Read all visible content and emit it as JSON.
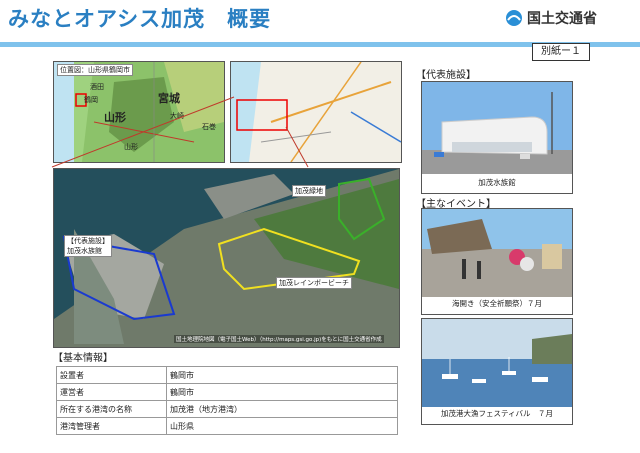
{
  "header": {
    "title": "みなとオアシス加茂　概要",
    "logo_text": "国土交通省",
    "annex": "別紙ー１"
  },
  "location_map": {
    "label": "位置図：山形県鶴岡市",
    "places": [
      "宮城",
      "山形",
      "鶴岡",
      "大崎",
      "酒田",
      "山形",
      "石巻"
    ]
  },
  "aerial": {
    "labels": {
      "facility": "【代表施設】\n加茂水族館",
      "green": "加茂緑地",
      "beach": "加茂レインボービーチ"
    },
    "credit": "国土地理院地図（電子国土Web）（http://maps.gsi.go.jp)をもとに国土交通省作成"
  },
  "rep_facility": {
    "heading": "【代表施設】",
    "caption": "加茂水族館"
  },
  "events": {
    "heading": "【主なイベント】",
    "items": [
      {
        "caption": "海開き（安全祈願祭）７月"
      },
      {
        "caption": "加茂港大漁フェスティバル　７月"
      }
    ]
  },
  "basic_info": {
    "heading": "【基本情報】",
    "rows": [
      {
        "key": "設置者",
        "value": "鶴岡市"
      },
      {
        "key": "運営者",
        "value": "鶴岡市"
      },
      {
        "key": "所在する港湾の名称",
        "value": "加茂港（地方港湾）"
      },
      {
        "key": "港湾管理者",
        "value": "山形県"
      }
    ]
  }
}
